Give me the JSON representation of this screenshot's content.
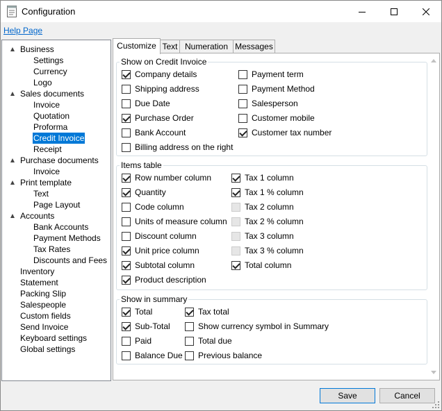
{
  "window": {
    "title": "Configuration"
  },
  "help_link": "Help Page",
  "tree": [
    {
      "label": "Business",
      "level": 0,
      "expanded": true
    },
    {
      "label": "Settings",
      "level": 1
    },
    {
      "label": "Currency",
      "level": 1
    },
    {
      "label": "Logo",
      "level": 1
    },
    {
      "label": "Sales documents",
      "level": 0,
      "expanded": true
    },
    {
      "label": "Invoice",
      "level": 1
    },
    {
      "label": "Quotation",
      "level": 1
    },
    {
      "label": "Proforma",
      "level": 1
    },
    {
      "label": "Credit Invoice",
      "level": 1,
      "selected": true
    },
    {
      "label": "Receipt",
      "level": 1
    },
    {
      "label": "Purchase documents",
      "level": 0,
      "expanded": true
    },
    {
      "label": "Invoice",
      "level": 1
    },
    {
      "label": "Print template",
      "level": 0,
      "expanded": true
    },
    {
      "label": "Text",
      "level": 1
    },
    {
      "label": "Page Layout",
      "level": 1
    },
    {
      "label": "Accounts",
      "level": 0,
      "expanded": true
    },
    {
      "label": "Bank Accounts",
      "level": 1
    },
    {
      "label": "Payment Methods",
      "level": 1
    },
    {
      "label": "Tax Rates",
      "level": 1
    },
    {
      "label": "Discounts and Fees",
      "level": 1
    },
    {
      "label": "Inventory",
      "level": 0
    },
    {
      "label": "Statement",
      "level": 0
    },
    {
      "label": "Packing Slip",
      "level": 0
    },
    {
      "label": "Salespeople",
      "level": 0
    },
    {
      "label": "Custom fields",
      "level": 0
    },
    {
      "label": "Send Invoice",
      "level": 0
    },
    {
      "label": "Keyboard settings",
      "level": 0
    },
    {
      "label": "Global settings",
      "level": 0
    }
  ],
  "tabs": [
    {
      "label": "Customize",
      "active": true
    },
    {
      "label": "Text"
    },
    {
      "label": "Numeration"
    },
    {
      "label": "Messages"
    }
  ],
  "groups": {
    "show_on": {
      "title": "Show on Credit Invoice",
      "col1": [
        {
          "label": "Company details",
          "checked": true
        },
        {
          "label": "Shipping address",
          "checked": false
        },
        {
          "label": "Due Date",
          "checked": false
        },
        {
          "label": "Purchase Order",
          "checked": true
        },
        {
          "label": "Bank Account",
          "checked": false
        },
        {
          "label": "Billing address on the right",
          "checked": false
        }
      ],
      "col2": [
        {
          "label": "Payment term",
          "checked": false
        },
        {
          "label": "Payment Method",
          "checked": false
        },
        {
          "label": "Salesperson",
          "checked": false
        },
        {
          "label": "Customer mobile",
          "checked": false
        },
        {
          "label": "Customer tax number",
          "checked": true
        }
      ]
    },
    "items_table": {
      "title": "Items table",
      "col1": [
        {
          "label": "Row number column",
          "checked": true
        },
        {
          "label": "Quantity",
          "checked": true
        },
        {
          "label": "Code column",
          "checked": false
        },
        {
          "label": "Units of measure column",
          "checked": false
        },
        {
          "label": "Discount column",
          "checked": false
        },
        {
          "label": "Unit price column",
          "checked": true
        },
        {
          "label": "Subtotal column",
          "checked": true
        },
        {
          "label": "Product description",
          "checked": true
        }
      ],
      "col2": [
        {
          "label": "Tax 1 column",
          "checked": true
        },
        {
          "label": "Tax 1 % column",
          "checked": true
        },
        {
          "label": "Tax 2 column",
          "checked": false,
          "disabled": true
        },
        {
          "label": "Tax 2 % column",
          "checked": false,
          "disabled": true
        },
        {
          "label": "Tax 3 column",
          "checked": false,
          "disabled": true
        },
        {
          "label": "Tax 3 % column",
          "checked": false,
          "disabled": true
        },
        {
          "label": "Total column",
          "checked": true
        }
      ]
    },
    "summary": {
      "title": "Show in summary",
      "col1": [
        {
          "label": "Total",
          "checked": true
        },
        {
          "label": "Sub-Total",
          "checked": true
        },
        {
          "label": "Paid",
          "checked": false
        },
        {
          "label": "Balance Due",
          "checked": false
        }
      ],
      "col2": [
        {
          "label": "Tax total",
          "checked": true
        },
        {
          "label": "Show currency symbol in Summary",
          "checked": false
        },
        {
          "label": "Total due",
          "checked": false
        },
        {
          "label": "Previous balance",
          "checked": false
        }
      ]
    }
  },
  "buttons": {
    "save": "Save",
    "cancel": "Cancel"
  }
}
